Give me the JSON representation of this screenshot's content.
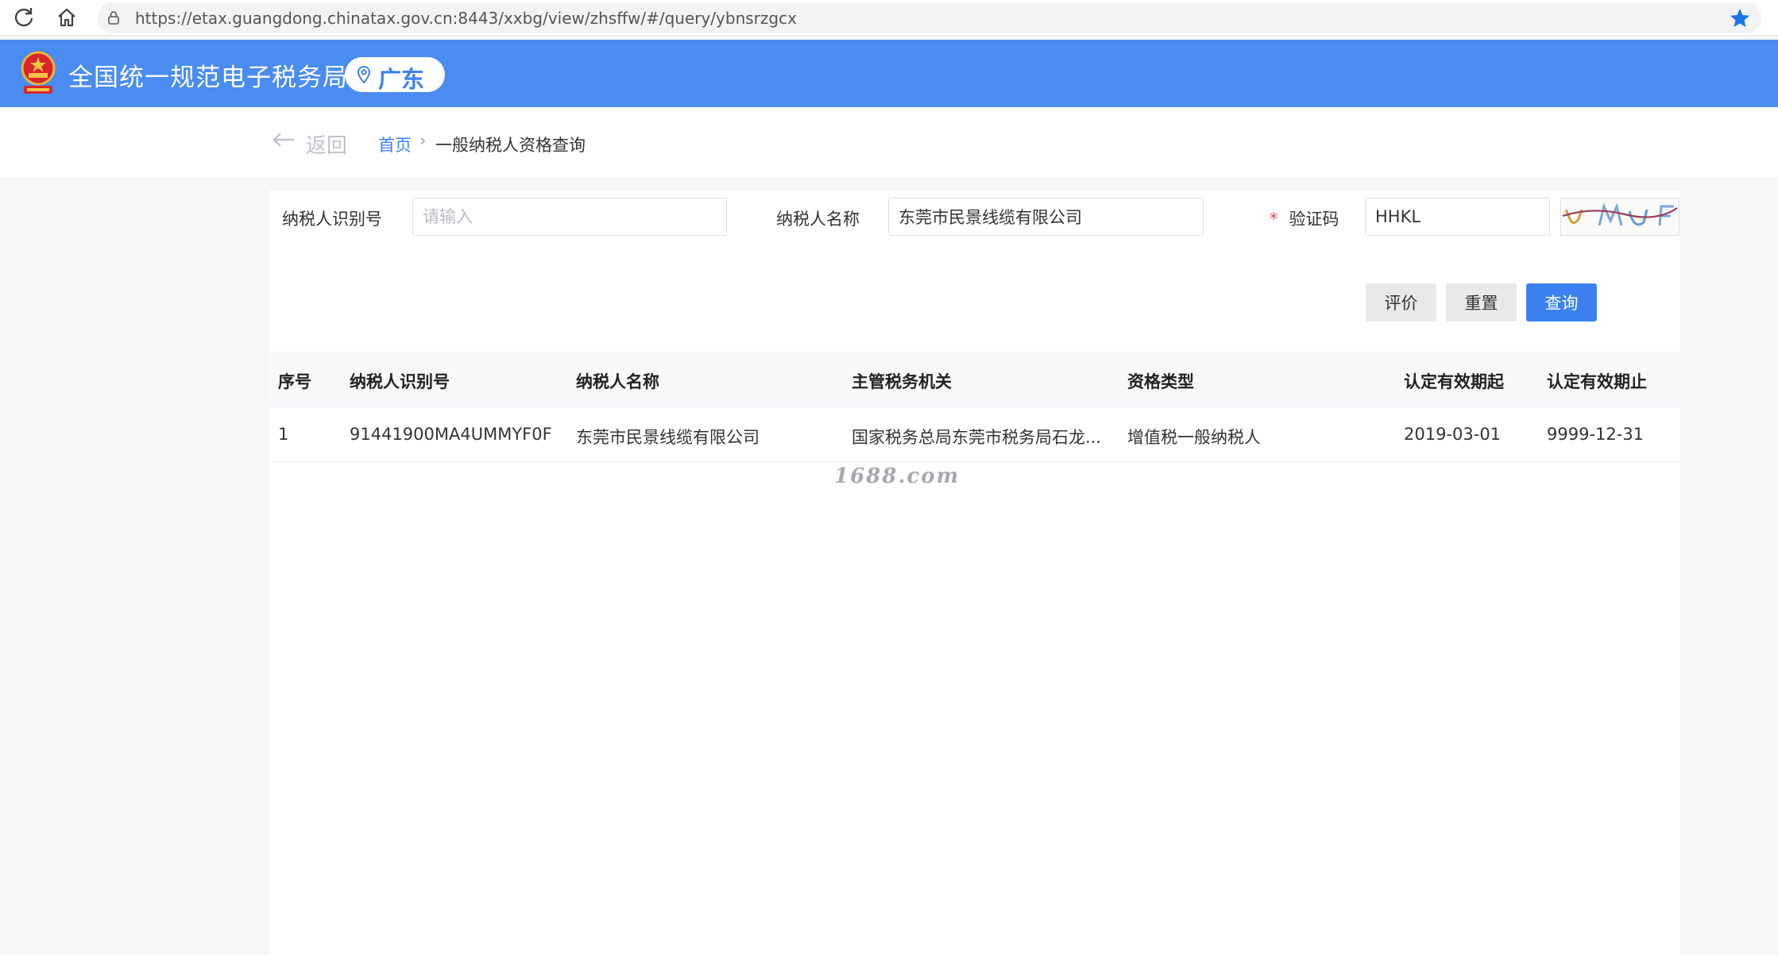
{
  "browser": {
    "url": "https://etax.guangdong.chinatax.gov.cn:8443/xxbg/view/zhsffw/#/query/ybnsrzgcx",
    "icons": [
      "reload-icon",
      "home-icon",
      "lock-icon",
      "bookmark-star-icon"
    ],
    "star_color": "#1a73e8"
  },
  "header": {
    "title": "全国统一规范电子税务局",
    "region": "广东",
    "bg_color": "#4a8cf0"
  },
  "subheader": {
    "back_label": "返回",
    "breadcrumb_home": "首页",
    "breadcrumb_sep": "›",
    "breadcrumb_current": "一般纳税人资格查询"
  },
  "form": {
    "taxpayer_id_label": "纳税人识别号",
    "taxpayer_id_value": "",
    "taxpayer_id_placeholder": "请输入",
    "taxpayer_name_label": "纳税人名称",
    "taxpayer_name_value": "东莞市民景线缆有限公司",
    "captcha_required_mark": "*",
    "captcha_label": "验证码",
    "captcha_value": "HHKL"
  },
  "buttons": {
    "evaluate": "评价",
    "reset": "重置",
    "query": "查询"
  },
  "table": {
    "columns": [
      "序号",
      "纳税人识别号",
      "纳税人名称",
      "主管税务机关",
      "资格类型",
      "认定有效期起",
      "认定有效期止"
    ],
    "rows": [
      [
        "1",
        "91441900MA4UMMYF0F",
        "东莞市民景线缆有限公司",
        "国家税务总局东莞市税务局石龙...",
        "增值税一般纳税人",
        "2019-03-01",
        "9999-12-31"
      ]
    ]
  },
  "watermark": "1688.com"
}
